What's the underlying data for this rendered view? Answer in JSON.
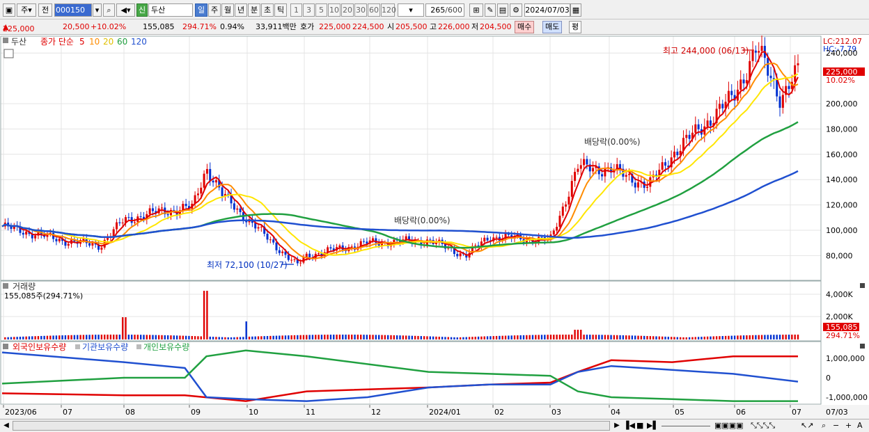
{
  "toolbar": {
    "stock_type": "주",
    "prev_label": "전",
    "code": "000150",
    "new_badge": "신",
    "name": "두산",
    "periods": [
      "일",
      "주",
      "월",
      "년",
      "분",
      "초",
      "틱"
    ],
    "intervals": [
      "1",
      "3",
      "5",
      "10",
      "20",
      "30",
      "60",
      "120"
    ],
    "count": "265",
    "count_total": "/600",
    "date": "2024/07/03"
  },
  "quote": {
    "price": "225,000",
    "change": "20,500",
    "change_pct": "+10.02%",
    "volume": "155,085",
    "vol_ratio": "294.71%",
    "turnover_pct": "0.94%",
    "amount": "33,911백만",
    "bid_label": "호가",
    "bid": "225,000",
    "ask": "224,500",
    "open_label": "시",
    "open": "205,500",
    "high_label": "고",
    "high": "226,000",
    "low_label": "저",
    "low": "204,500",
    "buy_btn": "매수",
    "sell_btn": "매도",
    "avg_btn": "평"
  },
  "price_panel": {
    "stock": "두산",
    "legend_prefix": "종가 단순",
    "ma_periods": [
      "5",
      "10",
      "20",
      "60",
      "120"
    ],
    "ma_colors": [
      "#e00000",
      "#ff8c00",
      "#ffe600",
      "#20a040",
      "#2050d0"
    ],
    "lc": "LC:212.07",
    "hc": "HC:-7.79",
    "price_tag": "225,000",
    "pct_tag": "10.02%",
    "high_note": "최고 244,000 (06/13)",
    "low_note": "최저 72,100 (10/27)",
    "div_note_1": "배당락(0.00%)",
    "div_note_2": "배당락(0.00%)",
    "y_ticks": [
      "240,000",
      "200,000",
      "180,000",
      "160,000",
      "140,000",
      "120,000",
      "100,000",
      "80,000"
    ]
  },
  "volume_panel": {
    "title": "거래량",
    "summary": "155,085주(294.71%)",
    "y_ticks": [
      "4,000K",
      "2,000K"
    ],
    "tag_value": "155,085",
    "tag_pct": "294.71%"
  },
  "holdings_panel": {
    "labels": [
      "외국인보유수량",
      "기관보유수량",
      "개인보유수량"
    ],
    "colors": [
      "#e00000",
      "#2050d0",
      "#20a040"
    ],
    "y_ticks": [
      "1,000,000",
      "0",
      "-1,000,000"
    ]
  },
  "x_axis": {
    "labels": [
      "2023/06",
      "07",
      "08",
      "09",
      "10",
      "11",
      "12",
      "2024/01",
      "02",
      "03",
      "04",
      "05",
      "06",
      "07"
    ],
    "last_date": "07/03"
  },
  "chart_data": {
    "type": "candlestick",
    "x_period": [
      "2023/06",
      "2024/07/03"
    ],
    "ylim": [
      70000,
      250000
    ],
    "close_series": [
      [
        "2023/06",
        103000
      ],
      [
        "2023/07",
        92000
      ],
      [
        "2023/07/20",
        88000
      ],
      [
        "2023/08",
        108000
      ],
      [
        "2023/08/20",
        115000
      ],
      [
        "2023/09/05",
        118000
      ],
      [
        "2023/09/12",
        150000
      ],
      [
        "2023/09/20",
        128000
      ],
      [
        "2023/10",
        110000
      ],
      [
        "2023/10/27",
        72100
      ],
      [
        "2023/11",
        80000
      ],
      [
        "2023/12",
        90000
      ],
      [
        "2024/01",
        92000
      ],
      [
        "2024/01/20",
        80000
      ],
      [
        "2024/02",
        95000
      ],
      [
        "2024/03",
        92000
      ],
      [
        "2024/03/15",
        150000
      ],
      [
        "2024/04",
        148000
      ],
      [
        "2024/04/20",
        135000
      ],
      [
        "2024/05",
        160000
      ],
      [
        "2024/06",
        205000
      ],
      [
        "2024/06/13",
        244000
      ],
      [
        "2024/06/25",
        205000
      ],
      [
        "2024/07/03",
        225000
      ]
    ],
    "ma_last": {
      "ma5": 212000,
      "ma10": 210000,
      "ma20": 205000,
      "ma60": 180000,
      "ma120": 143000
    },
    "volume_peak": "2023/09",
    "holdings_last": {
      "외국인보유수량": 1100000,
      "기관보유수량": -200000,
      "개인보유수량": -1200000
    }
  }
}
